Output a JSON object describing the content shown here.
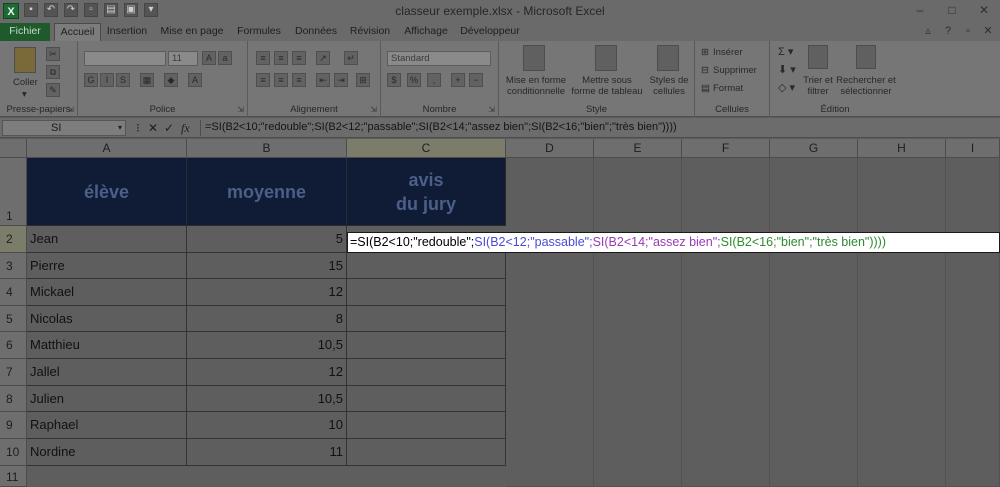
{
  "window": {
    "title": "classeur exemple.xlsx - Microsoft Excel",
    "app_letter": "X",
    "controls": [
      "–",
      "□",
      "✕"
    ]
  },
  "ribbon": {
    "tabs": [
      {
        "label": "Fichier",
        "active": false
      },
      {
        "label": "Accueil",
        "active": true
      },
      {
        "label": "Insertion",
        "active": false
      },
      {
        "label": "Mise en page",
        "active": false
      },
      {
        "label": "Formules",
        "active": false
      },
      {
        "label": "Données",
        "active": false
      },
      {
        "label": "Révision",
        "active": false
      },
      {
        "label": "Affichage",
        "active": false
      },
      {
        "label": "Développeur",
        "active": false
      }
    ],
    "clipboard": {
      "paste_label": "Coller",
      "group_label": "Presse-papiers"
    },
    "font": {
      "group_label": "Police",
      "font_name": "",
      "font_size": "11"
    },
    "alignment": {
      "group_label": "Alignement"
    },
    "number": {
      "group_label": "Nombre",
      "format": "Standard"
    },
    "style": {
      "group_label": "Style",
      "cond_format": "Mise en forme conditionnelle",
      "table_format": "Mettre sous forme de tableau",
      "cell_styles": "Styles de cellules"
    },
    "cells": {
      "group_label": "Cellules",
      "insert": "Insérer",
      "delete": "Supprimer",
      "format": "Format"
    },
    "editing": {
      "group_label": "Édition",
      "sort_filter": "Trier et filtrer",
      "find_select": "Rechercher et sélectionner"
    }
  },
  "formula_bar": {
    "name_box": "SI",
    "fx": "fx",
    "formula": "=SI(B2<10;\"redouble\";SI(B2<12;\"passable\";SI(B2<14;\"assez bien\";SI(B2<16;\"bien\";\"très bien\"))))"
  },
  "sheet": {
    "columns": [
      "A",
      "B",
      "C",
      "D",
      "E",
      "F",
      "G",
      "H",
      "I"
    ],
    "headers": {
      "col_a": "élève",
      "col_b": "moyenne",
      "col_c_line1": "avis",
      "col_c_line2": "du jury"
    },
    "rows": [
      {
        "num": "1"
      },
      {
        "num": "2",
        "name": "Jean",
        "avg": "5"
      },
      {
        "num": "3",
        "name": "Pierre",
        "avg": "15"
      },
      {
        "num": "4",
        "name": "Mickael",
        "avg": "12"
      },
      {
        "num": "5",
        "name": "Nicolas",
        "avg": "8"
      },
      {
        "num": "6",
        "name": "Matthieu",
        "avg": "10,5"
      },
      {
        "num": "7",
        "name": "Jallel",
        "avg": "12"
      },
      {
        "num": "8",
        "name": "Julien",
        "avg": "10,5"
      },
      {
        "num": "9",
        "name": "Raphael",
        "avg": "10"
      },
      {
        "num": "10",
        "name": "Nordine",
        "avg": "11"
      },
      {
        "num": "11"
      }
    ],
    "editing_cell": {
      "part1": "=SI(B2<10;\"redouble\";",
      "part2": "SI(B2<12;\"passable\";",
      "part3": "SI(B2<14;\"assez bien\";",
      "part4": "SI(B2<16;\"bien\";\"très bien\"))))"
    }
  }
}
